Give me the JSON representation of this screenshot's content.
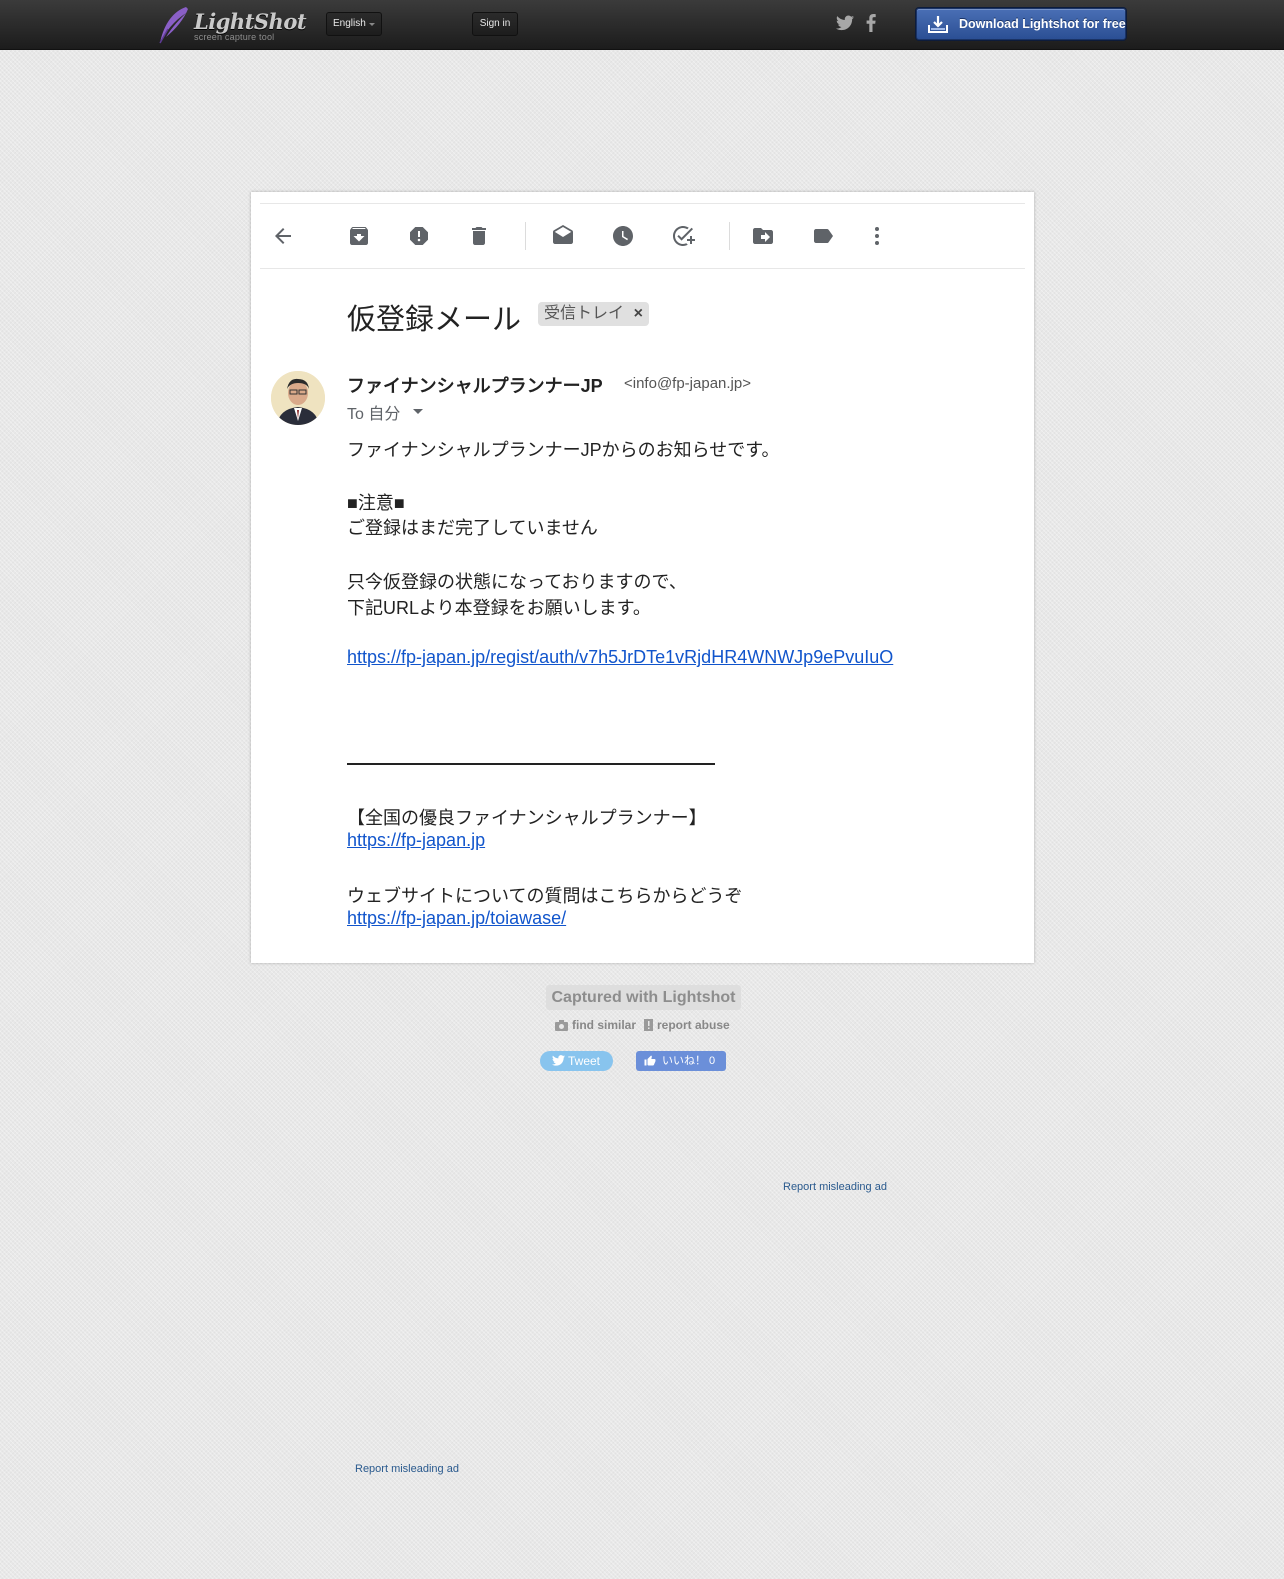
{
  "header": {
    "logo_title": "LightShot",
    "logo_subtitle": "screen capture tool",
    "language": "English",
    "signin_label": "Sign in",
    "download_label": "Download Lightshot for free"
  },
  "email": {
    "subject": "仮登録メール",
    "label_chip": "受信トレイ",
    "sender_name": "ファイナンシャルプランナーJP",
    "sender_email": "<info@fp-japan.jp>",
    "to_line": "To 自分",
    "body": {
      "line1": "ファイナンシャルプランナーJPからのお知らせです。",
      "line2": "■注意■",
      "line3": "ご登録はまだ完了していません",
      "line4": "只今仮登録の状態になっておりますので、",
      "line5": "下記URLより本登録をお願いします。",
      "link1": "https://fp-japan.jp/regist/auth/v7h5JrDTe1vRjdHR4WNWJp9ePvuIuO",
      "line6": "【全国の優良ファイナンシャルプランナー】",
      "link2": "https://fp-japan.jp",
      "line7": "ウェブサイトについての質問はこちらからどうぞ",
      "link3": "https://fp-japan.jp/toiawase/"
    }
  },
  "footer": {
    "captured_label": "Captured with Lightshot",
    "find_similar": "find similar",
    "report_abuse": "report abuse",
    "tweet_label": "Tweet",
    "like_label": "いいね！ 0",
    "report_ad_1": "Report misleading ad",
    "report_ad_2": "Report misleading ad"
  },
  "toolbar_icons": [
    "back-arrow-icon",
    "archive-icon",
    "report-spam-icon",
    "delete-icon",
    "mark-unread-icon",
    "snooze-icon",
    "add-task-icon",
    "move-to-icon",
    "labels-icon",
    "more-vert-icon"
  ],
  "colors": {
    "header_bg": "#2a2a2a",
    "download_bg": "#2b4f94",
    "link": "#1155cc",
    "report_ad": "#2a5a8e"
  }
}
